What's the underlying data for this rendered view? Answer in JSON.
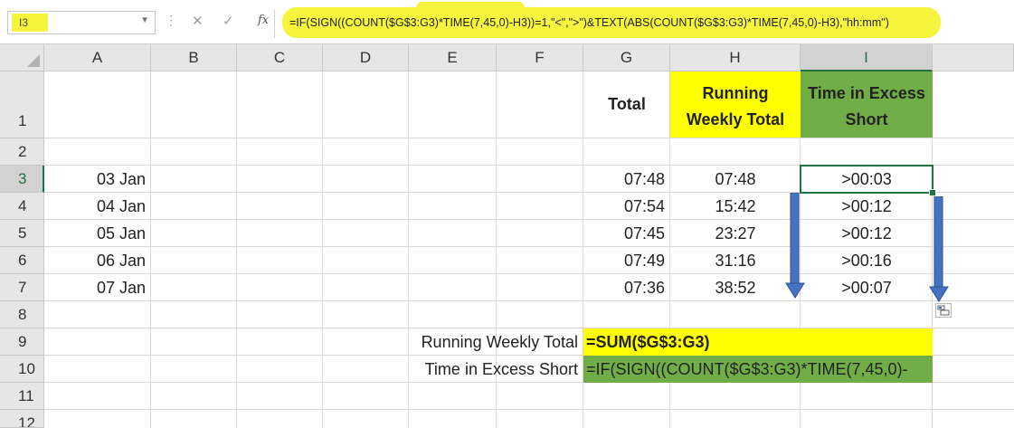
{
  "formula_bar": {
    "name_box": "I3",
    "cancel_symbol": "✕",
    "enter_symbol": "✓",
    "fx_label": "fx",
    "formula": "=IF(SIGN((COUNT($G$3:G3)*TIME(7,45,0)-H3))=1,\"<\",\">\")&TEXT(ABS(COUNT($G$3:G3)*TIME(7,45,0)-H3),\"hh:mm\")"
  },
  "columns": [
    "A",
    "B",
    "C",
    "D",
    "E",
    "F",
    "G",
    "H",
    "I"
  ],
  "rows": [
    "1",
    "2",
    "3",
    "4",
    "5",
    "6",
    "7",
    "8",
    "9",
    "10",
    "11",
    "12"
  ],
  "headers": {
    "total": "Total",
    "running_line1": "Running",
    "running_line2": "Weekly Total",
    "excess_line1": "Time in Excess",
    "excess_line2": "Short"
  },
  "data_rows": [
    {
      "date": "03 Jan",
      "total": "07:48",
      "running": "07:48",
      "excess": ">00:03"
    },
    {
      "date": "04 Jan",
      "total": "07:54",
      "running": "15:42",
      "excess": ">00:12"
    },
    {
      "date": "05 Jan",
      "total": "07:45",
      "running": "23:27",
      "excess": ">00:12"
    },
    {
      "date": "06 Jan",
      "total": "07:49",
      "running": "31:16",
      "excess": ">00:16"
    },
    {
      "date": "07 Jan",
      "total": "07:36",
      "running": "38:52",
      "excess": ">00:07"
    }
  ],
  "notes": {
    "label1": "Running Weekly Total",
    "formula1": "=SUM($G$3:G3)",
    "label2": "Time in Excess Short",
    "formula2": "=IF(SIGN((COUNT($G$3:G3)*TIME(7,45,0)-"
  },
  "colors": {
    "highlight_yellow": "#f6f43d",
    "header_yellow": "#ffff00",
    "header_green": "#70ad47",
    "selection_green": "#217346",
    "arrow_blue": "#4472c4"
  }
}
